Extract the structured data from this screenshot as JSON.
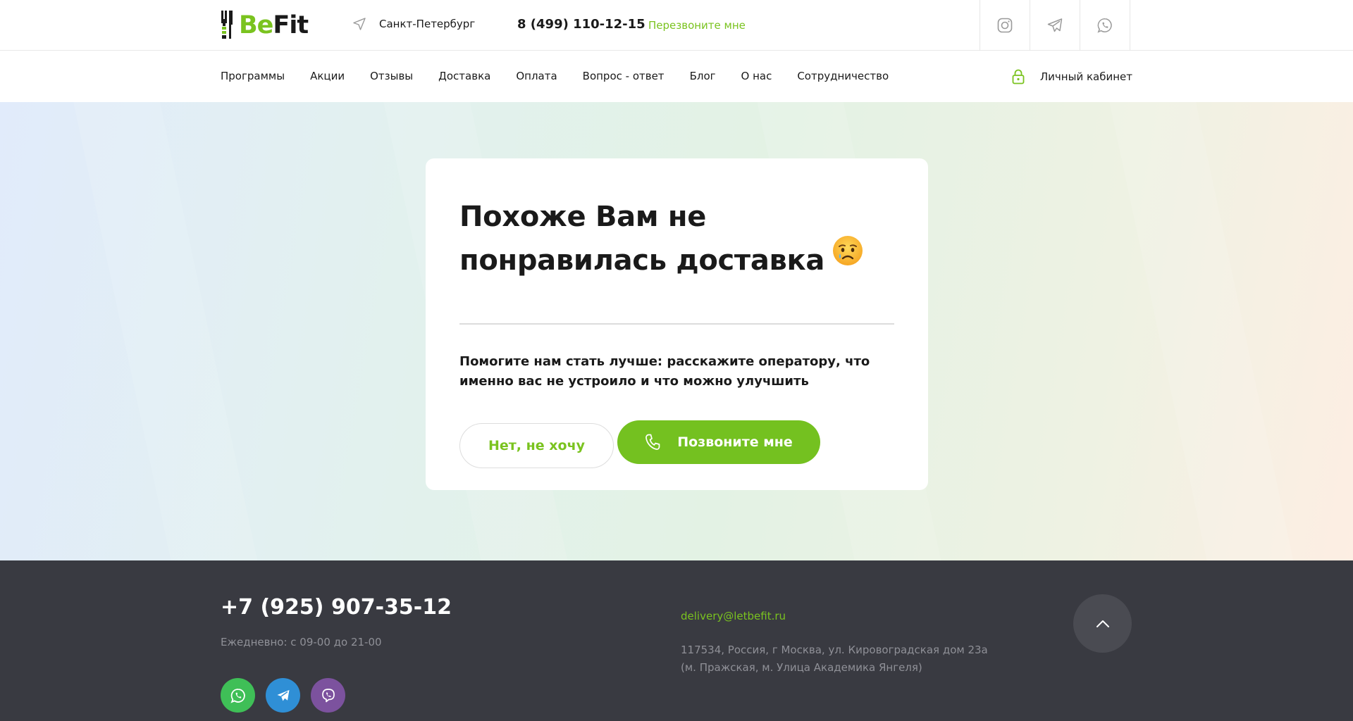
{
  "header": {
    "logo": {
      "be": "Be",
      "fit": "Fit"
    },
    "city": "Санкт-Петербург",
    "phone": "8 (499) 110-12-15",
    "callback": "Перезвоните мне",
    "social": [
      {
        "icon": "instagram-icon"
      },
      {
        "icon": "telegram-icon"
      },
      {
        "icon": "whatsapp-icon"
      }
    ]
  },
  "nav": {
    "items": [
      {
        "label": "Программы"
      },
      {
        "label": "Акции"
      },
      {
        "label": "Отзывы"
      },
      {
        "label": "Доставка"
      },
      {
        "label": "Оплата"
      },
      {
        "label": "Вопрос - ответ"
      },
      {
        "label": "Блог"
      },
      {
        "label": "О нас"
      },
      {
        "label": "Сотрудничество"
      }
    ],
    "account": "Личный кабинет"
  },
  "card": {
    "title_line1": "Похоже Вам не",
    "title_line2": "понравилась доставка",
    "text": "Помогите нам стать лучше: расскажите оператору, что именно вас не устроило и что можно улучшить",
    "btn_no": "Нет, не хочу",
    "btn_call": "Позвоните мне"
  },
  "footer": {
    "phone": "+7 (925) 907-35-12",
    "hours": "Ежедневно: с 09-00 до 21-00",
    "email": "delivery@letbefit.ru",
    "address_line1": "117534, Россия, г Москва, ул. Кировоградская дом 23а",
    "address_line2": "(м. Пражская, м. Улица Академика Янгеля)"
  },
  "colors": {
    "accent": "#74c120",
    "footer_bg": "#393a41",
    "whatsapp": "#3fbf57",
    "telegram": "#2f8fd6",
    "viber": "#7c529e"
  }
}
